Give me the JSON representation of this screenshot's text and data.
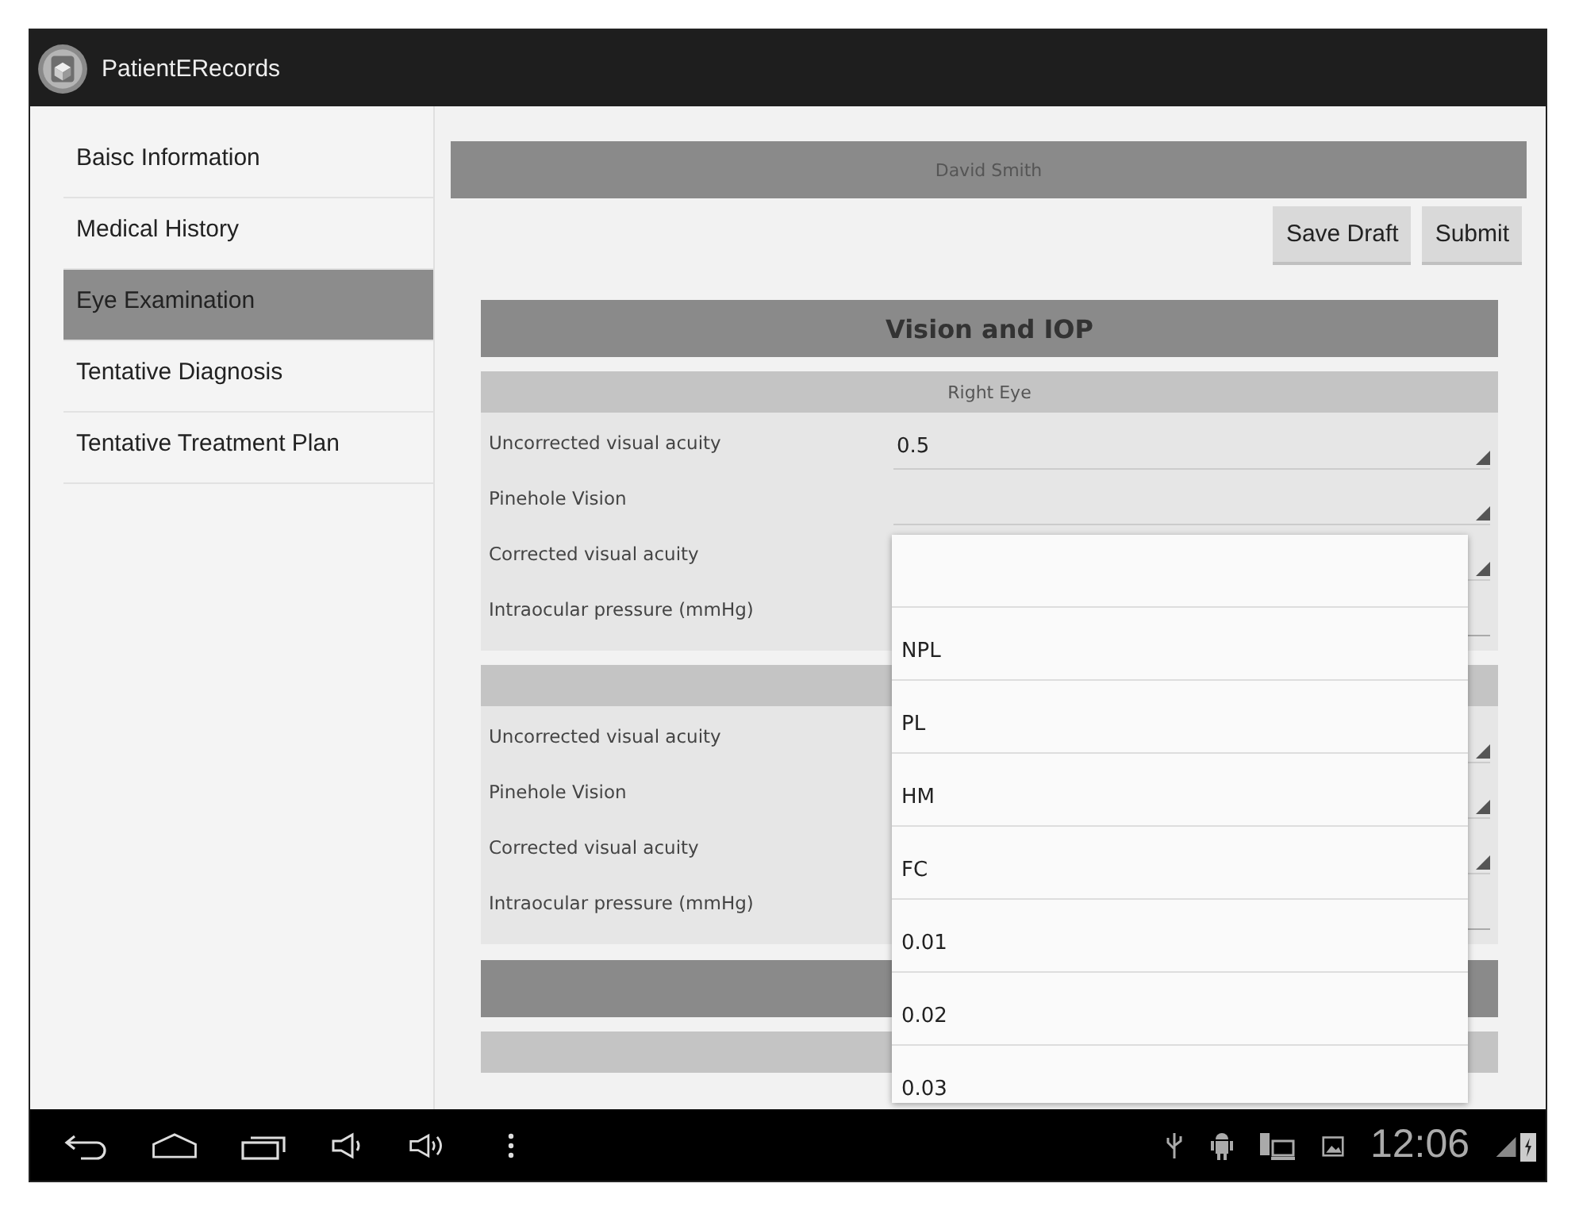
{
  "app_bar": {
    "title": "PatientERecords"
  },
  "sidebar": {
    "items": [
      {
        "label": "Baisc Information",
        "selected": false
      },
      {
        "label": "Medical History",
        "selected": false
      },
      {
        "label": "Eye Examination",
        "selected": true
      },
      {
        "label": "Tentative Diagnosis",
        "selected": false
      },
      {
        "label": "Tentative Treatment Plan",
        "selected": false
      }
    ]
  },
  "patient_name": "David Smith",
  "buttons": [
    "Save Draft",
    "Submit"
  ],
  "section": {
    "title": "Vision and IOP",
    "groups": [
      {
        "header": "Right Eye",
        "fields": [
          {
            "label": "Uncorrected visual acuity",
            "kind": "spinner",
            "value": "0.5"
          },
          {
            "label": "Pinehole Vision",
            "kind": "spinner"
          },
          {
            "label": "Corrected visual acuity",
            "kind": "spinner"
          },
          {
            "label": "Intraocular pressure (mmHg)",
            "kind": "text"
          }
        ]
      },
      {
        "fields": [
          {
            "label": "Uncorrected visual acuity",
            "kind": "spinner"
          },
          {
            "label": "Pinehole Vision",
            "kind": "spinner"
          },
          {
            "label": "Corrected visual acuity",
            "kind": "spinner"
          },
          {
            "label": "Intraocular pressure (mmHg)",
            "kind": "text"
          }
        ]
      }
    ]
  },
  "dropdown": {
    "options": [
      {
        "selected": false
      },
      {
        "label": "NPL",
        "selected": false
      },
      {
        "label": "PL",
        "selected": false
      },
      {
        "label": "HM",
        "selected": false
      },
      {
        "label": "FC",
        "selected": false
      },
      {
        "label": "0.01",
        "selected": false
      },
      {
        "label": "0.02",
        "selected": false
      },
      {
        "label": "0.03",
        "selected": false
      }
    ]
  },
  "status_bar": {
    "time": "12:06"
  }
}
